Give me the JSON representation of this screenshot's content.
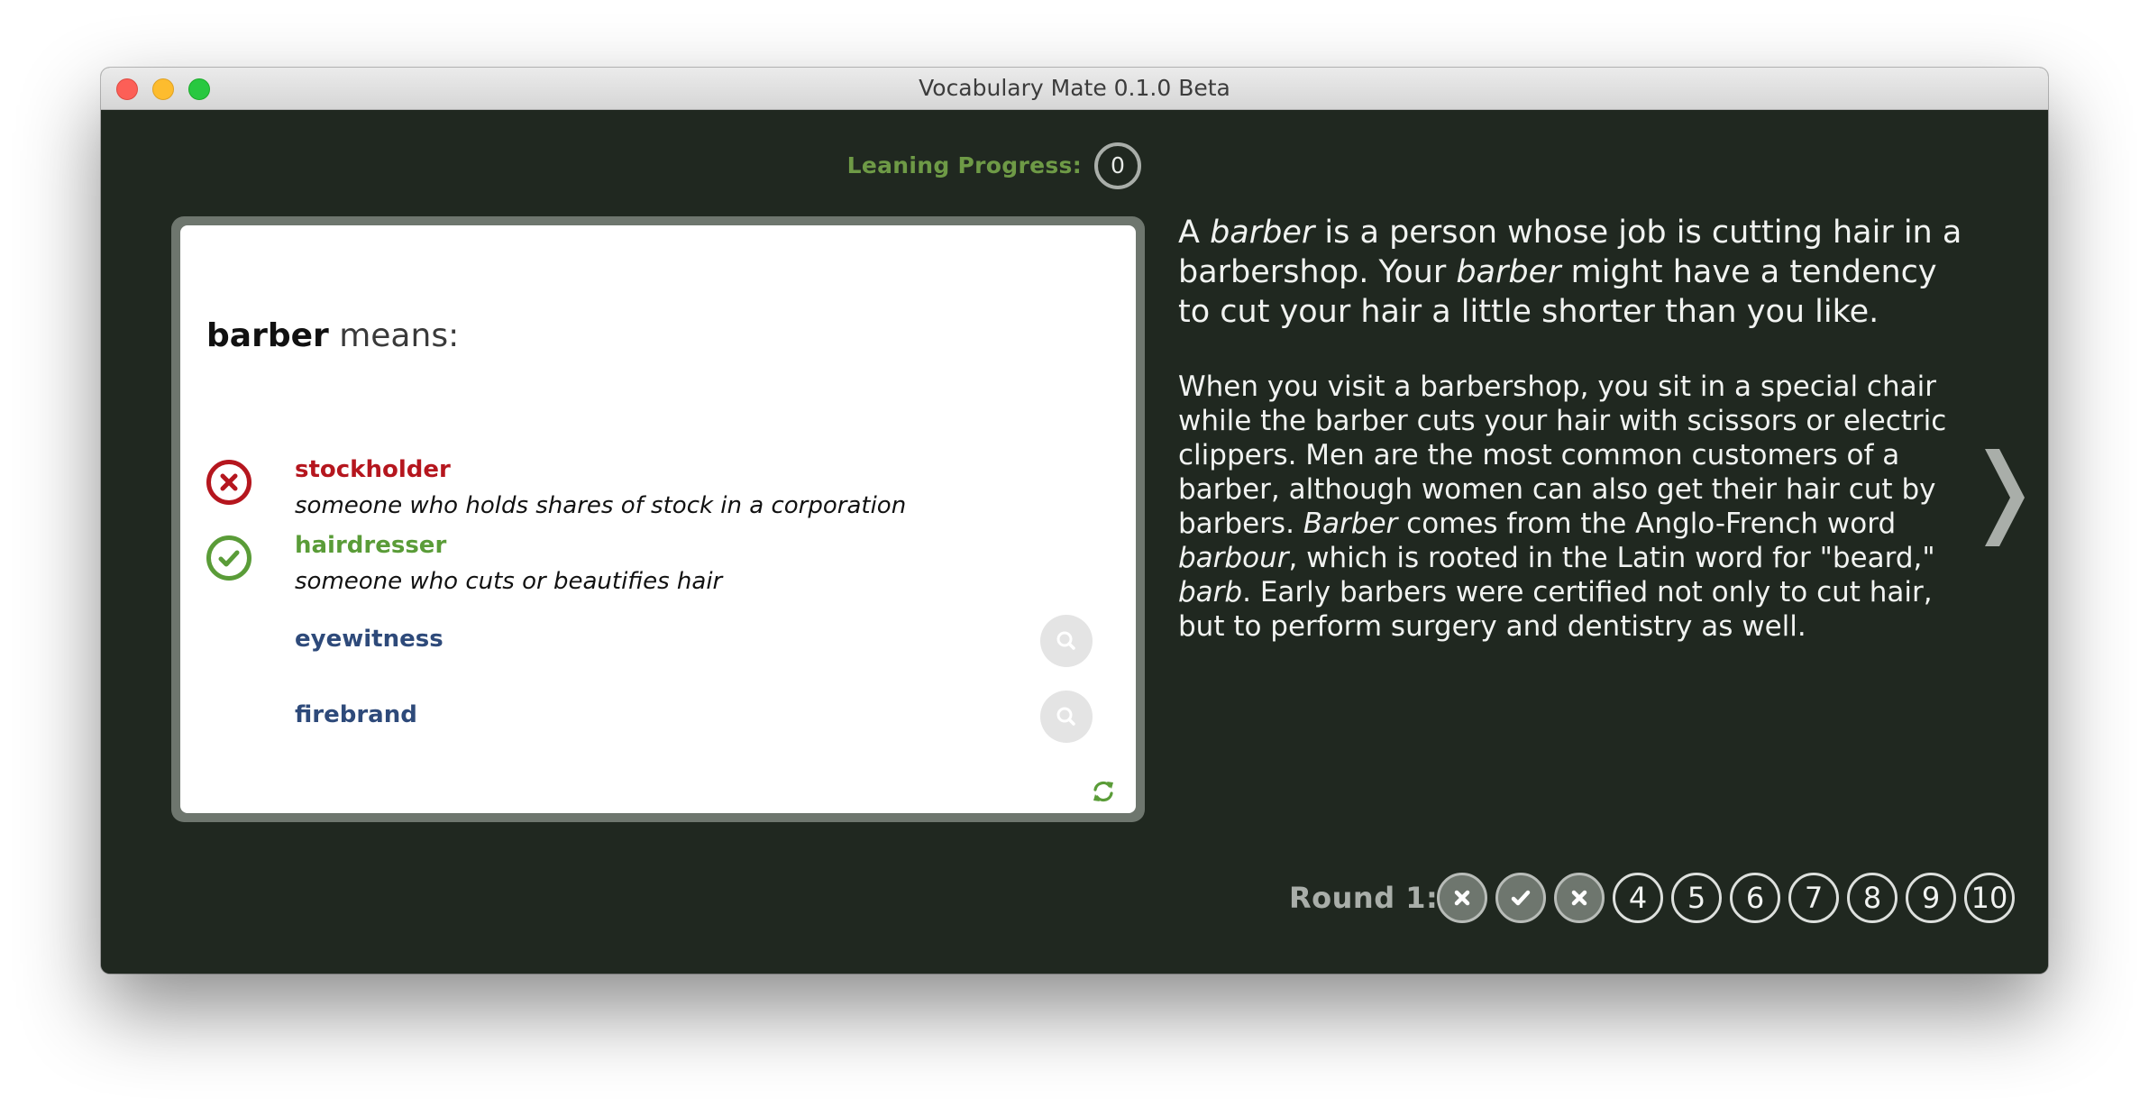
{
  "window": {
    "title": "Vocabulary Mate 0.1.0 Beta"
  },
  "progress": {
    "label": "Leaning Progress:",
    "value": "0"
  },
  "question": {
    "word": "barber",
    "suffix": "means:",
    "choices": [
      {
        "word": "stockholder",
        "gloss": "someone who holds shares of stock in a corporation",
        "state": "wrong"
      },
      {
        "word": "hairdresser",
        "gloss": "someone who cuts or beautifies hair",
        "state": "correct"
      },
      {
        "word": "eyewitness",
        "state": "unanswered"
      },
      {
        "word": "firebrand",
        "state": "unanswered"
      }
    ]
  },
  "definition": {
    "short": {
      "p1": "A ",
      "w1": "barber",
      "p2": " is a person whose job is cutting hair in a barbershop. Your ",
      "w2": "barber",
      "p3": " might have a tendency to cut your hair a little shorter than you like."
    },
    "long": {
      "p1": "When you visit a barbershop, you sit in a special chair while the barber cuts your hair with scissors or electric clippers. Men are the most common customers of a barber, although women can also get their hair cut by barbers. ",
      "w1": "Barber",
      "p2": " comes from the Anglo-French word ",
      "w2": "barbour",
      "p3": ", which is rooted in the Latin word for \"beard,\" ",
      "w3": "barb",
      "p4": ". Early barbers were certified not only to cut hair, but to perform surgery and dentistry as well."
    }
  },
  "round": {
    "label": "Round 1:",
    "items": [
      {
        "label": "",
        "state": "wrong",
        "icon": "x-icon"
      },
      {
        "label": "",
        "state": "correct",
        "icon": "check-icon"
      },
      {
        "label": "",
        "state": "wrong",
        "icon": "x-icon"
      },
      {
        "label": "4",
        "state": "pending"
      },
      {
        "label": "5",
        "state": "pending"
      },
      {
        "label": "6",
        "state": "pending"
      },
      {
        "label": "7",
        "state": "pending"
      },
      {
        "label": "8",
        "state": "pending"
      },
      {
        "label": "9",
        "state": "pending"
      },
      {
        "label": "10",
        "state": "pending"
      }
    ]
  },
  "icons": {
    "wrong": "x-circle-icon",
    "correct": "check-circle-icon",
    "lookup": "search-icon",
    "refresh": "refresh-icon",
    "next": "chevron-right-icon"
  },
  "colors": {
    "background": "#202820",
    "wrong": "#b5161e",
    "correct": "#5a9c38",
    "neutral_word": "#2e4a7a",
    "progress_label": "#6e9a46",
    "card_frame": "#6e766e"
  }
}
